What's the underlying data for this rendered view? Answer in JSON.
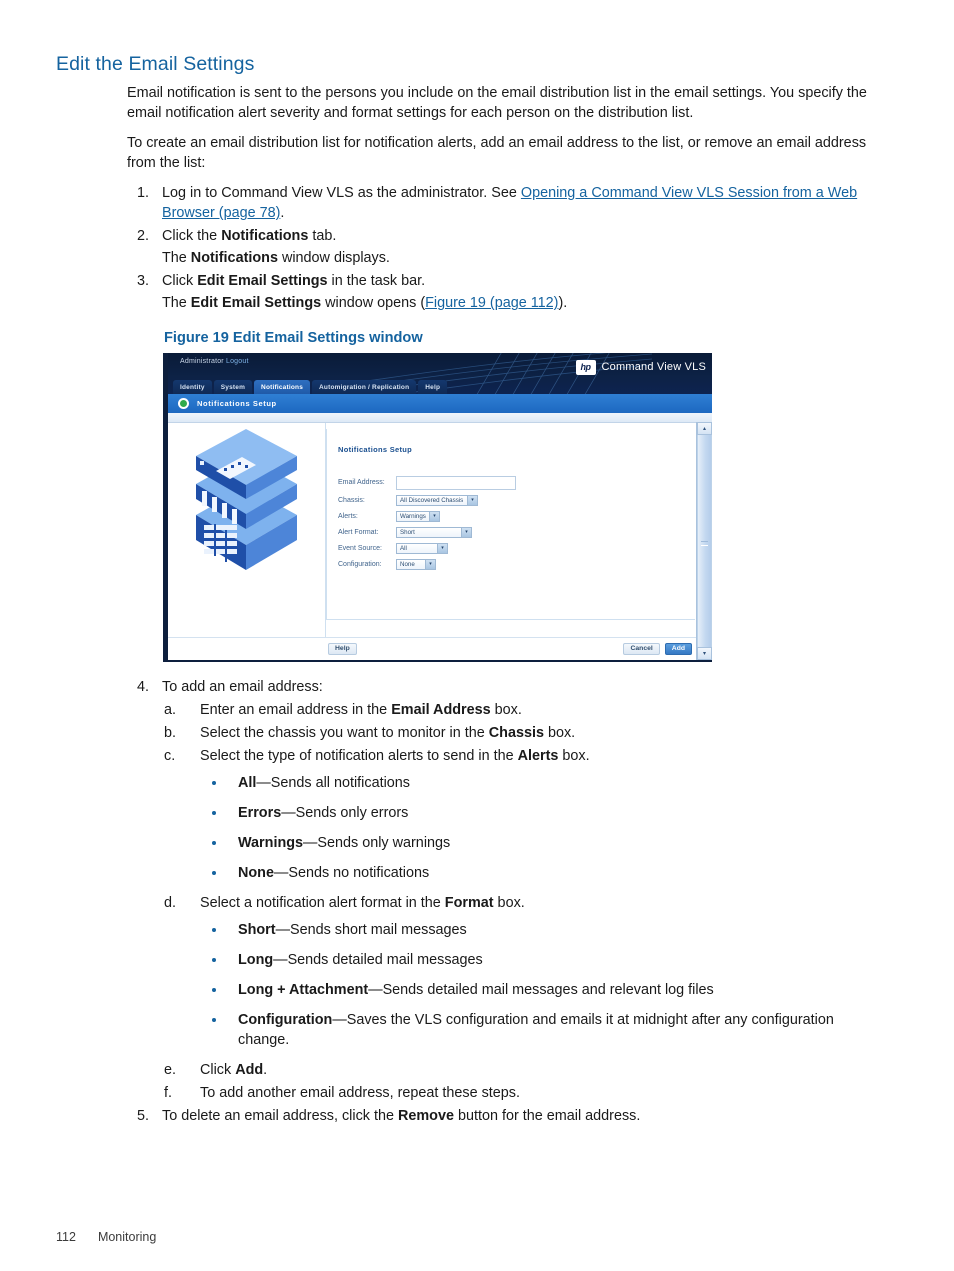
{
  "heading": "Edit the Email Settings",
  "intro": {
    "p1": "Email notification is sent to the persons you include on the email distribution list in the email settings. You specify the email notification alert severity and format settings for each person on the distribution list.",
    "p2": "To create an email distribution list for notification alerts, add an email address to the list, or remove an email address from the list:"
  },
  "steps": {
    "s1": {
      "num": "1.",
      "text_a": "Log in to Command View VLS as the administrator. See ",
      "link": "Opening a Command View VLS Session from a Web Browser (page 78)",
      "text_b": "."
    },
    "s2": {
      "num": "2.",
      "text_a": "Click the ",
      "bold": "Notifications",
      "text_b": " tab.",
      "note_a": "The ",
      "note_bold": "Notifications",
      "note_b": " window displays."
    },
    "s3": {
      "num": "3.",
      "text_a": "Click ",
      "bold": "Edit Email Settings",
      "text_b": " in the task bar.",
      "note_a": "The ",
      "note_bold": "Edit Email Settings",
      "note_b": " window opens (",
      "note_link": "Figure 19 (page 112)",
      "note_c": ")."
    },
    "s4": {
      "num": "4.",
      "text": "To add an email address:",
      "sub": [
        {
          "num": "a.",
          "text_a": "Enter an email address in the ",
          "bold": "Email Address",
          "text_b": " box."
        },
        {
          "num": "b.",
          "text_a": "Select the chassis you want to monitor in the ",
          "bold": "Chassis",
          "text_b": " box."
        },
        {
          "num": "c.",
          "text_a": "Select the type of notification alerts to send in the ",
          "bold": "Alerts",
          "text_b": " box."
        },
        {
          "num": "d.",
          "text_a": "Select a notification alert format in the ",
          "bold": "Format",
          "text_b": " box."
        },
        {
          "num": "e.",
          "text_a": "Click ",
          "bold": "Add",
          "text_b": "."
        },
        {
          "num": "f.",
          "text_a": "To add another email address, repeat these steps.",
          "bold": "",
          "text_b": ""
        }
      ],
      "alert_bullets": [
        {
          "term": "All",
          "desc": "—Sends all notifications"
        },
        {
          "term": "Errors",
          "desc": "—Sends only errors"
        },
        {
          "term": "Warnings",
          "desc": "—Sends only warnings"
        },
        {
          "term": "None",
          "desc": "—Sends no notifications"
        }
      ],
      "format_bullets": [
        {
          "term": "Short",
          "desc": "—Sends short mail messages"
        },
        {
          "term": "Long",
          "desc": "—Sends detailed mail messages"
        },
        {
          "term": "Long + Attachment",
          "desc": "—Sends detailed mail messages and relevant log files"
        },
        {
          "term": "Configuration",
          "desc": "—Saves the VLS configuration and emails it at midnight after any configuration change."
        }
      ]
    },
    "s5": {
      "num": "5.",
      "text_a": "To delete an email address, click the ",
      "bold": "Remove",
      "text_b": " button for the email address."
    }
  },
  "figure": {
    "caption": "Figure 19 Edit Email Settings window",
    "app": {
      "admin_label": "Administrator",
      "logout_label": "Logout",
      "logo_text": "hp",
      "brand": "Command View VLS",
      "tabs": [
        {
          "label": "Identity",
          "active": false
        },
        {
          "label": "System",
          "active": false
        },
        {
          "label": "Notifications",
          "active": true
        },
        {
          "label": "Automigration / Replication",
          "active": false
        },
        {
          "label": "Help",
          "active": false
        }
      ],
      "page_bar_title": "Notifications Setup",
      "panel_title": "Notifications Setup",
      "form": [
        {
          "label": "Email Address:",
          "type": "text",
          "value": ""
        },
        {
          "label": "Chassis:",
          "type": "select",
          "value": "All Discovered Chassis"
        },
        {
          "label": "Alerts:",
          "type": "select",
          "value": "Warnings"
        },
        {
          "label": "Alert Format:",
          "type": "select",
          "value": "Short"
        },
        {
          "label": "Event Source:",
          "type": "select",
          "value": "All"
        },
        {
          "label": "Configuration:",
          "type": "select",
          "value": "None"
        }
      ],
      "buttons": {
        "help": "Help",
        "cancel": "Cancel",
        "add": "Add"
      },
      "caret": "▾",
      "scroll_up": "▴",
      "scroll_down": "▾"
    }
  },
  "footer": {
    "page_number": "112",
    "chapter": "Monitoring"
  },
  "colors": {
    "heading_blue": "#15639f",
    "link_blue": "#15639f",
    "app_navy": "#0d2350",
    "app_bar_blue": "#1d68c0",
    "device_blue": "#5b9bea"
  }
}
